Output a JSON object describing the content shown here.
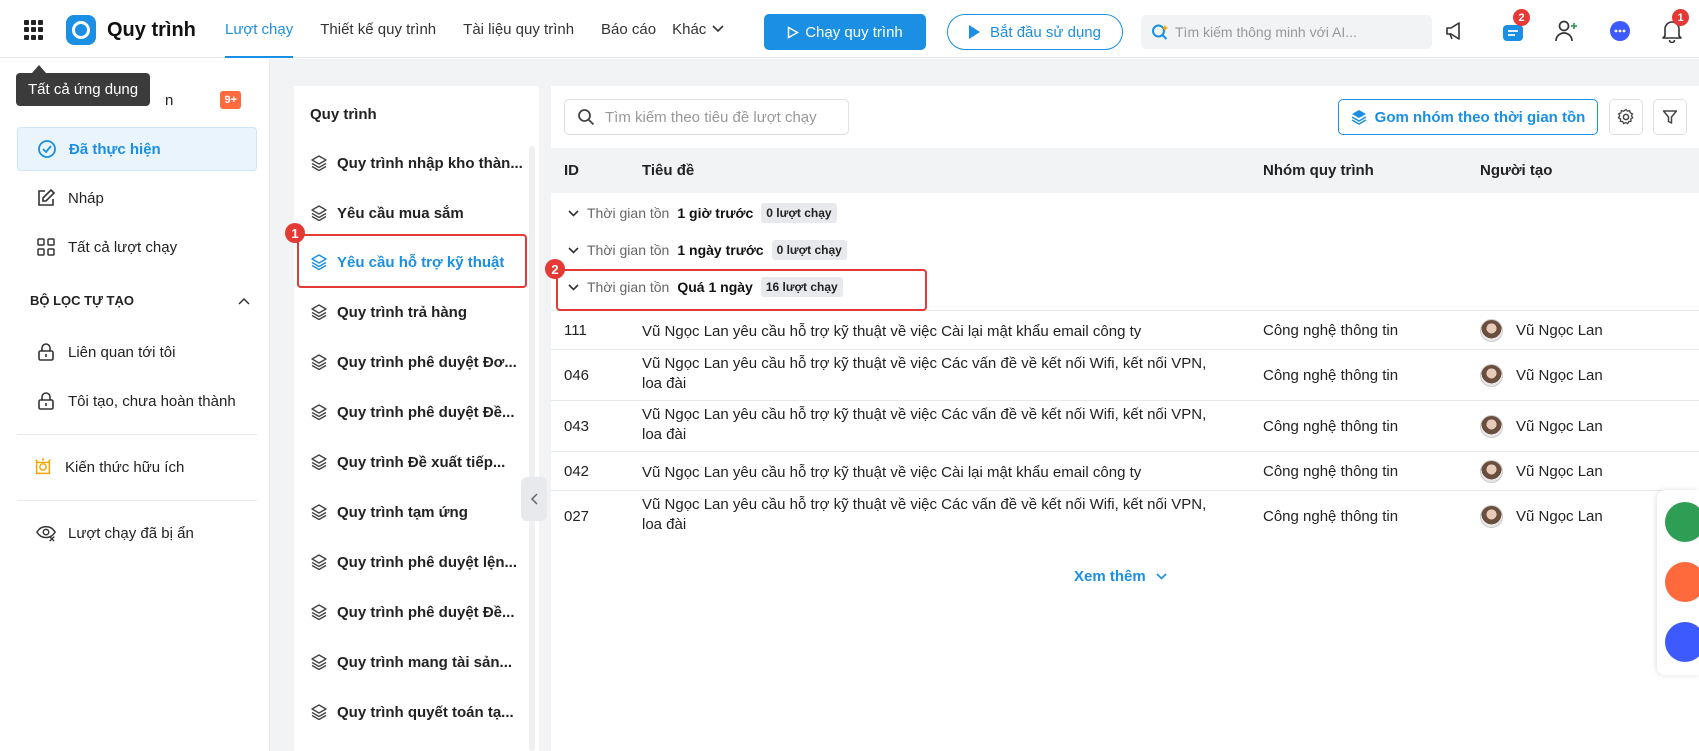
{
  "topbar": {
    "app_title": "Quy trình",
    "nav": [
      "Lượt chạy",
      "Thiết kế quy trình",
      "Tài liệu quy trình",
      "Báo cáo"
    ],
    "nav_more": "Khác",
    "run_button": "Chạy quy trình",
    "start_button": "Bắt đầu sử dụng",
    "ai_search_placeholder": "Tìm kiếm thông minh với AI...",
    "cart_badge": "2",
    "bell_badge": "1"
  },
  "tooltip": "Tất cả ứng dụng",
  "sidebar": {
    "first_item_suffix": "n",
    "first_item_badge": "9+",
    "items": [
      "Đã thực hiện",
      "Nháp",
      "Tất cả lượt chạy"
    ],
    "section_title": "BỘ LỌC TỰ TẠO",
    "filters": [
      "Liên quan tới tôi",
      "Tôi tạo, chưa hoàn thành"
    ],
    "knowledge": "Kiến thức hữu ích",
    "hidden_runs": "Lượt chạy đã bị ẩn"
  },
  "processes": {
    "heading": "Quy trình",
    "items": [
      "Quy trình nhập kho thàn...",
      "Yêu cầu mua sắm",
      "Yêu cầu hỗ trợ kỹ thuật",
      "Quy trình trả hàng",
      "Quy trình phê duyệt Đơ...",
      "Quy trình phê duyệt Đề...",
      "Quy trình Đề xuất tiếp...",
      "Quy trình tạm ứng",
      "Quy trình phê duyệt lện...",
      "Quy trình phê duyệt Đề...",
      "Quy trình mang tài sản...",
      "Quy trình quyết toán tạ..."
    ]
  },
  "main": {
    "search_placeholder": "Tìm kiếm theo tiêu đề lượt chạy",
    "group_button": "Gom nhóm theo thời gian tồn",
    "columns": [
      "ID",
      "Tiêu đề",
      "Nhóm quy trình",
      "Người tạo"
    ],
    "groups": [
      {
        "label": "Thời gian tồn",
        "value": "1 giờ trước",
        "count": "0 lượt chạy"
      },
      {
        "label": "Thời gian tồn",
        "value": "1 ngày trước",
        "count": "0 lượt chạy"
      },
      {
        "label": "Thời gian tồn",
        "value": "Quá 1 ngày",
        "count": "16 lượt chạy"
      }
    ],
    "rows": [
      {
        "id": "111",
        "title": "Vũ Ngọc Lan yêu cầu hỗ trợ kỹ thuật về việc Cài lại mật khẩu email công ty",
        "group": "Công nghệ thông tin",
        "user": "Vũ Ngọc Lan"
      },
      {
        "id": "046",
        "title": "Vũ Ngọc Lan yêu cầu hỗ trợ kỹ thuật về việc Các vấn đề về kết nối Wifi, kết nối VPN, loa đài",
        "group": "Công nghệ thông tin",
        "user": "Vũ Ngọc Lan"
      },
      {
        "id": "043",
        "title": "Vũ Ngọc Lan yêu cầu hỗ trợ kỹ thuật về việc Các vấn đề về kết nối Wifi, kết nối VPN, loa đài",
        "group": "Công nghệ thông tin",
        "user": "Vũ Ngọc Lan"
      },
      {
        "id": "042",
        "title": "Vũ Ngọc Lan yêu cầu hỗ trợ kỹ thuật về việc Cài lại mật khẩu email công ty",
        "group": "Công nghệ thông tin",
        "user": "Vũ Ngọc Lan"
      },
      {
        "id": "027",
        "title": "Vũ Ngọc Lan yêu cầu hỗ trợ kỹ thuật về việc Các vấn đề về kết nối Wifi, kết nối VPN, loa đài",
        "group": "Công nghệ thông tin",
        "user": "Vũ Ngọc Lan"
      }
    ],
    "see_more": "Xem thêm"
  },
  "annotations": [
    "1",
    "2"
  ],
  "colors": {
    "accent": "#1a8fe3",
    "highlight": "#e53935",
    "badge_orange": "#ff6a3d"
  }
}
